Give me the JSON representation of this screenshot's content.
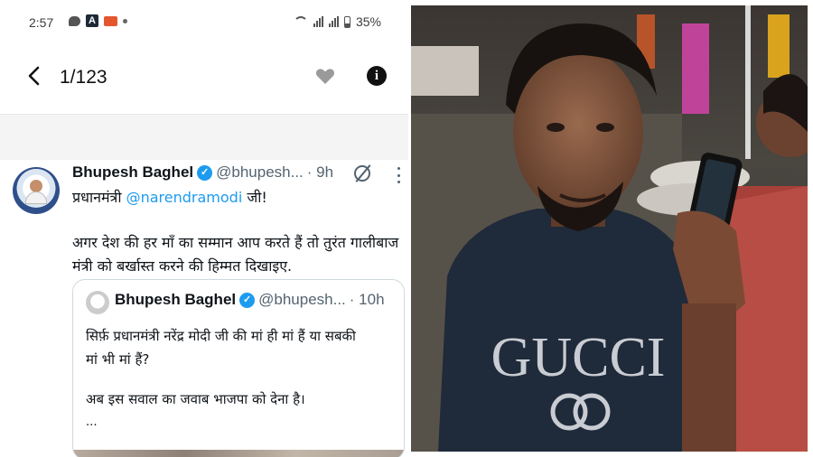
{
  "status_bar": {
    "time": "2:57",
    "battery": "35%"
  },
  "nav": {
    "counter": "1/123"
  },
  "tweet": {
    "name": "Bhupesh Baghel",
    "handle": "@bhupesh...",
    "time": "· 9h",
    "line1_prefix": "प्रधानमंत्री",
    "line1_mention": "@narendramodi",
    "line1_suffix": "जी!",
    "line2": "अगर देश की हर माँ का सम्मान आप करते हैं तो तुरंत गालीबाज",
    "line3": "मंत्री को बर्खास्त करने की हिम्मत दिखाइए.",
    "quote": {
      "name": "Bhupesh Baghel",
      "handle": "@bhupesh...",
      "time": "· 10h",
      "line1": "सिर्फ़ प्रधानमंत्री नरेंद्र मोदी जी की मां ही मां हैं या सबकी",
      "line2": "मां भी मां हैं?",
      "line3": "अब इस सवाल का जवाब भाजपा को देना है।",
      "ellipsis": "..."
    }
  },
  "photo": {
    "shirt_text": "GUCCI"
  },
  "colors": {
    "accent_blue": "#1d9bf0",
    "text_primary": "#0f1419",
    "text_secondary": "#536471"
  }
}
